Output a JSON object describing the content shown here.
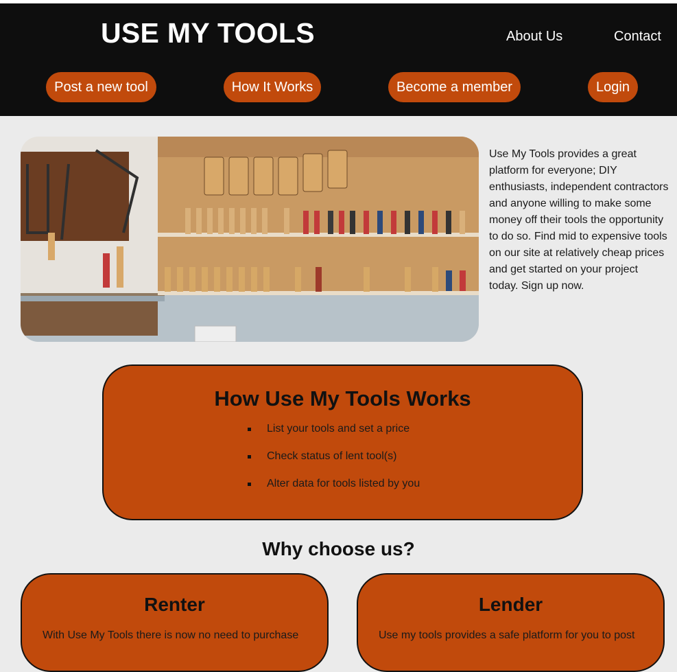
{
  "header": {
    "logo": "USE MY TOOLS",
    "links": [
      "About Us",
      "Contact"
    ],
    "nav": [
      "Post a new tool",
      "How It Works",
      "Become a member",
      "Login"
    ]
  },
  "hero": {
    "text": "Use My Tools provides a great platform for everyone; DIY enthusiasts, independent contractors and anyone willing to make some money off their tools the opportunity to do so. Find mid to expensive tools on our site at relatively cheap prices and get started on your project today. Sign up now."
  },
  "how": {
    "title": "How Use My Tools Works",
    "items": [
      "List your tools and set a price",
      "Check status of lent tool(s)",
      "Alter data for tools listed by you"
    ]
  },
  "why": {
    "title": "Why choose us?",
    "cards": [
      {
        "title": "Renter",
        "text": "With Use My Tools there is now no need to purchase"
      },
      {
        "title": "Lender",
        "text": "Use my tools provides a safe platform for you to post"
      }
    ]
  },
  "colors": {
    "accent": "#c14a0c",
    "header_bg": "#0e0e0e",
    "page_bg": "#ebebeb"
  }
}
